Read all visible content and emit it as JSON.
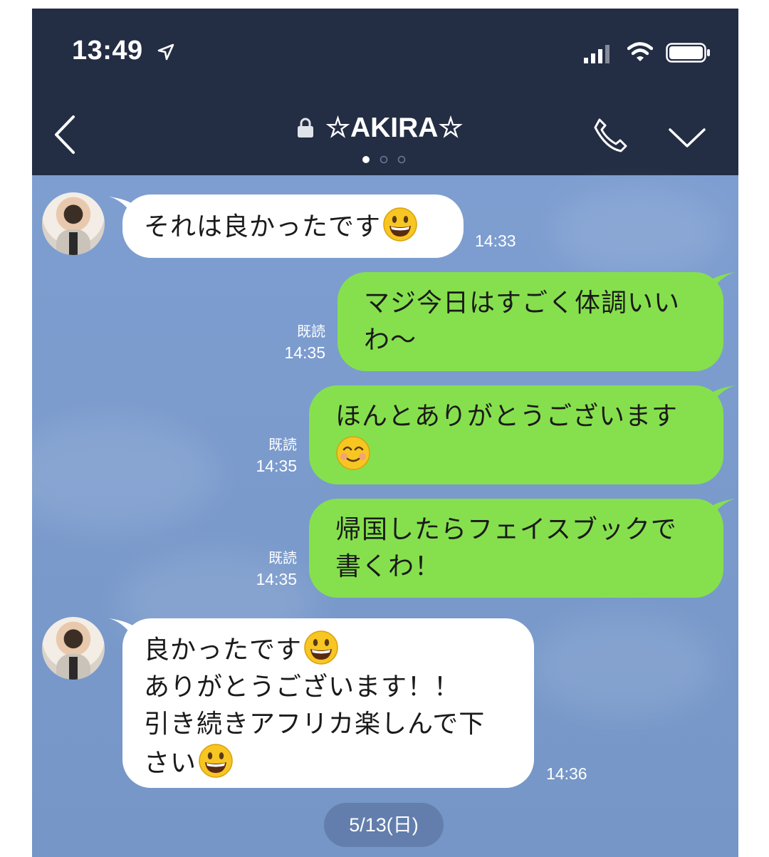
{
  "status_bar": {
    "time": "13:49"
  },
  "header": {
    "title": "☆AKIRA☆"
  },
  "messages": [
    {
      "direction": "in",
      "lines": [
        "それは良かったです"
      ],
      "time": "14:33"
    },
    {
      "direction": "out",
      "lines": [
        "マジ今日はすごく体調いい",
        "わ〜"
      ],
      "read": "既読",
      "time": "14:35"
    },
    {
      "direction": "out",
      "lines": [
        "ほんとありがとうございます"
      ],
      "read": "既読",
      "time": "14:35"
    },
    {
      "direction": "out",
      "lines": [
        "帰国したらフェイスブックで",
        "書くわ！"
      ],
      "read": "既読",
      "time": "14:35"
    },
    {
      "direction": "in",
      "lines": [
        "良かったです",
        "ありがとうございます！！",
        "引き続きアフリカ楽しんで下",
        "さい"
      ],
      "time": "14:36"
    }
  ],
  "date_divider": "5/13(日)",
  "colors": {
    "header_bg": "#232d44",
    "chat_bg": "#7b9bcd",
    "outgoing_bubble": "#86e04d",
    "incoming_bubble": "#ffffff"
  }
}
